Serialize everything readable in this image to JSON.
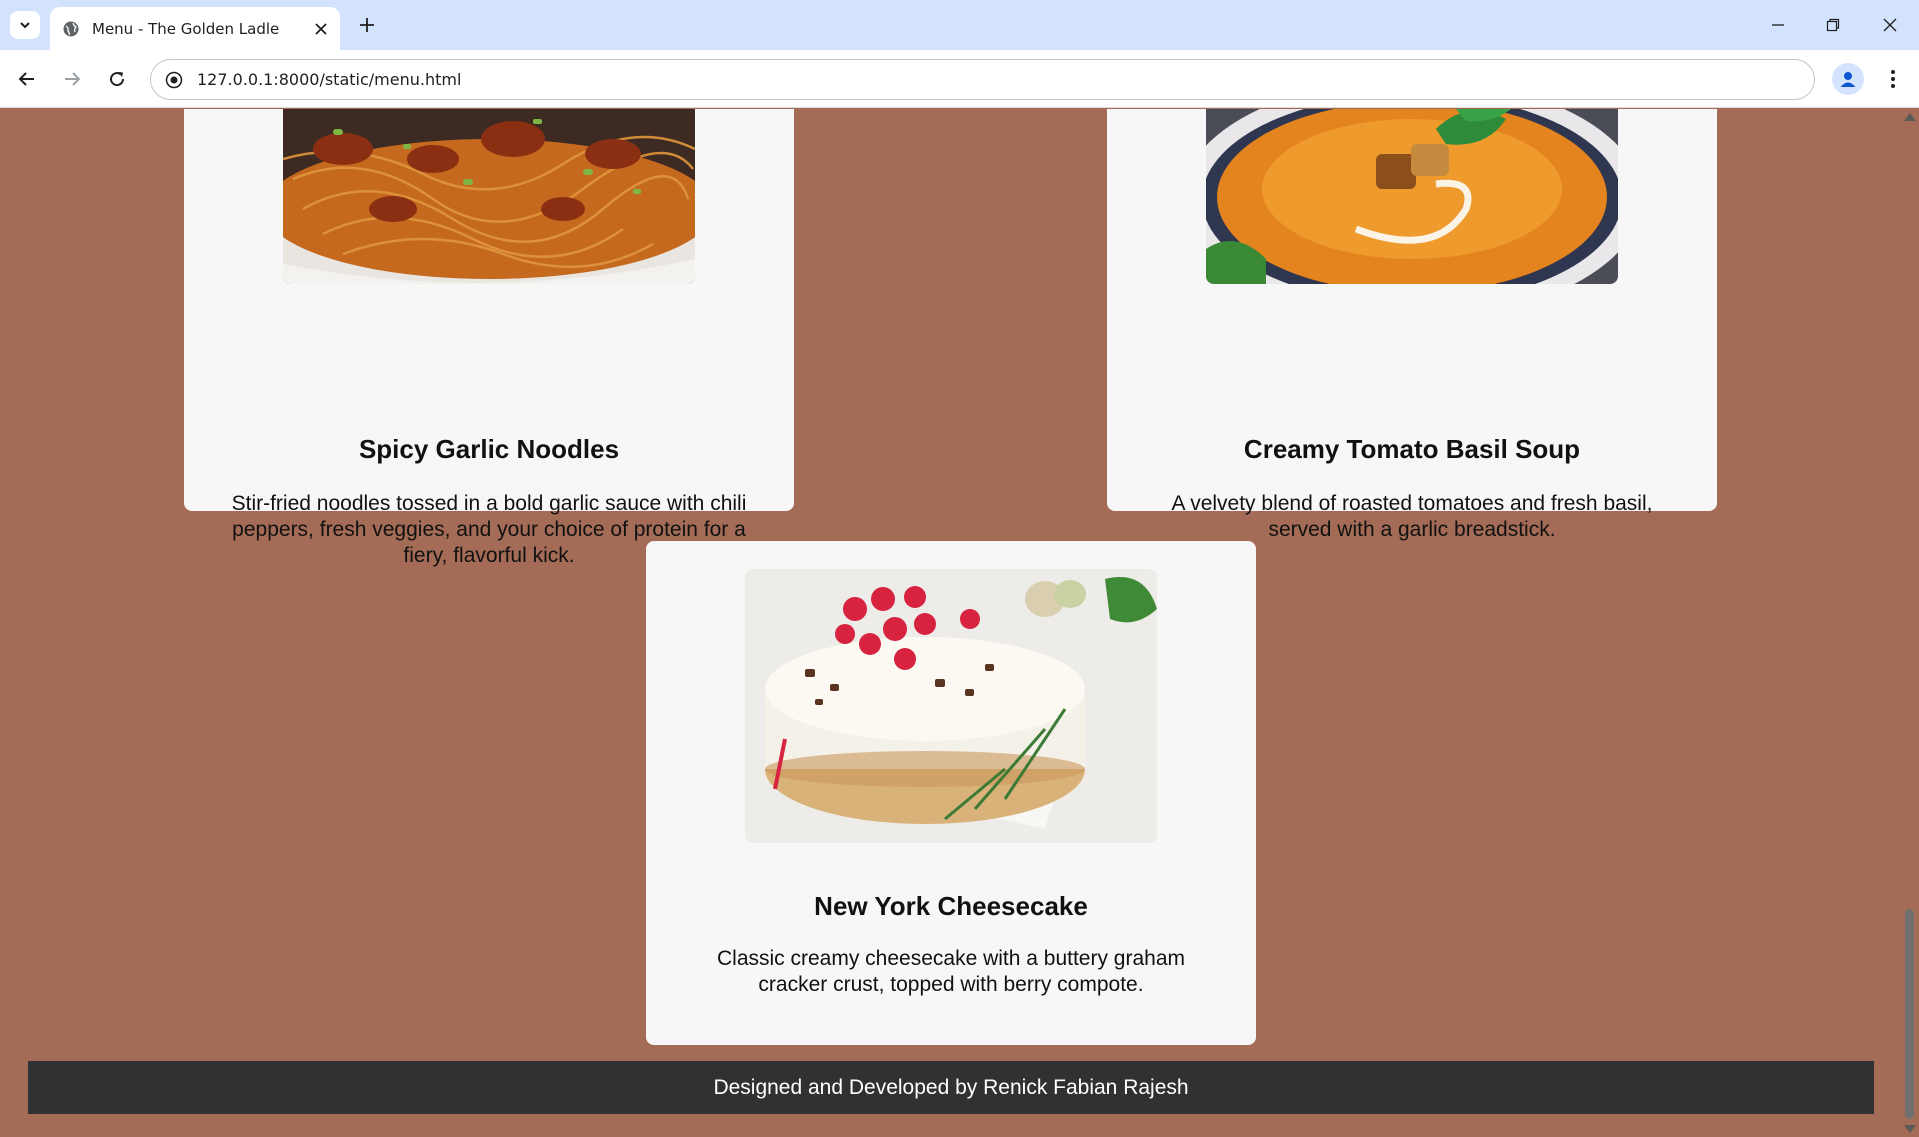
{
  "browser": {
    "tab_title": "Menu - The Golden Ladle",
    "url": "127.0.0.1:8000/static/menu.html"
  },
  "menu": {
    "items": [
      {
        "title": "Spicy Garlic Noodles",
        "description": "Stir-fried noodles tossed in a bold garlic sauce with chili peppers, fresh veggies, and your choice of protein for a fiery, flavorful kick."
      },
      {
        "title": "Creamy Tomato Basil Soup",
        "description": "A velvety blend of roasted tomatoes and fresh basil, served with a garlic breadstick."
      },
      {
        "title": "New York Cheesecake",
        "description": "Classic creamy cheesecake with a buttery graham cracker crust, topped with berry compote."
      }
    ]
  },
  "footer": {
    "text": "Designed and Developed by Renick Fabian Rajesh"
  },
  "colors": {
    "page_background": "#a46c56",
    "card_background": "#f7f7f7",
    "footer_background": "#2f3132",
    "tabbar_background": "#d3e3fd"
  }
}
